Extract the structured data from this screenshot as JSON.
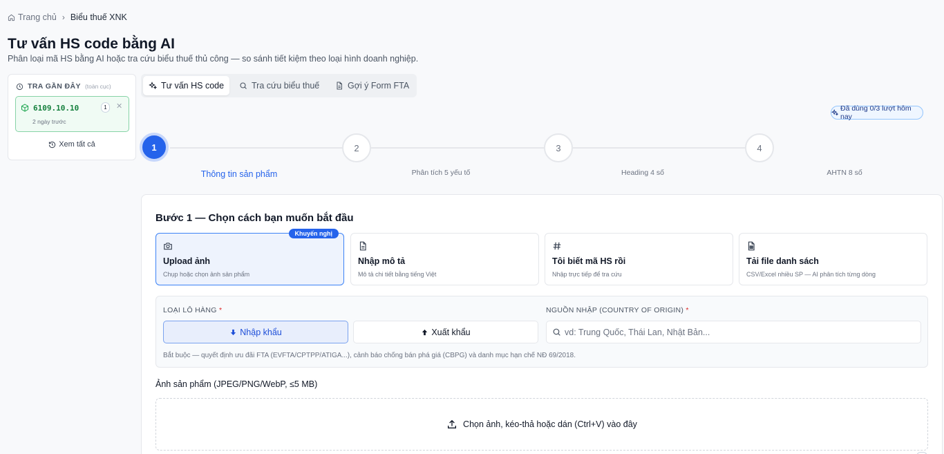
{
  "breadcrumb": {
    "home": "Trang chủ",
    "current": "Biểu thuế XNK"
  },
  "page": {
    "title": "Tư vấn HS code bằng AI",
    "subtitle": "Phân loại mã HS bằng AI hoặc tra cứu biểu thuế thủ công — so sánh tiết kiệm theo loại hình doanh nghiệp."
  },
  "recent": {
    "title": "TRA GẦN ĐÂY",
    "scope": "(toàn cục)",
    "items": [
      {
        "code": "6109.10.10",
        "count": "1",
        "time": "2 ngày trước"
      }
    ],
    "view_all": "Xem tất cả"
  },
  "tabs": [
    {
      "label": "Tư vấn HS code",
      "icon": "sparkles-icon",
      "active": true
    },
    {
      "label": "Tra cứu biểu thuế",
      "icon": "search-icon",
      "active": false
    },
    {
      "label": "Gợi ý Form FTA",
      "icon": "document-icon",
      "active": false
    }
  ],
  "usage": {
    "label": "Đã dùng 0/3 lượt hôm nay"
  },
  "steps": [
    {
      "num": "1",
      "label": "Thông tin sản phẩm",
      "active": true
    },
    {
      "num": "2",
      "label": "Phân tích 5 yếu tố",
      "active": false
    },
    {
      "num": "3",
      "label": "Heading 4 số",
      "active": false
    },
    {
      "num": "4",
      "label": "AHTN 8 số",
      "active": false
    }
  ],
  "step1": {
    "title": "Bước 1 — Chọn cách bạn muốn bắt đầu",
    "options": [
      {
        "name": "Upload ảnh",
        "desc": "Chụp hoặc chọn ảnh sản phẩm",
        "icon": "camera-icon",
        "badge": "Khuyến nghị",
        "active": true
      },
      {
        "name": "Nhập mô tả",
        "desc": "Mô tả chi tiết bằng tiếng Việt",
        "icon": "file-text-icon",
        "active": false
      },
      {
        "name": "Tôi biết mã HS rồi",
        "desc": "Nhập trực tiếp để tra cứu",
        "icon": "hash-icon",
        "active": false
      },
      {
        "name": "Tải file danh sách",
        "desc": "CSV/Excel nhiều SP — AI phân tích từng dòng",
        "icon": "spreadsheet-icon",
        "active": false
      }
    ]
  },
  "shipment": {
    "label": "LOẠI LÔ HÀNG",
    "req": "*",
    "import_label": "Nhập khẩu",
    "export_label": "Xuất khẩu",
    "selected": "import"
  },
  "origin": {
    "label": "NGUỒN NHẬP (COUNTRY OF ORIGIN)",
    "req": "*",
    "placeholder": "vd: Trung Quốc, Thái Lan, Nhật Bản...",
    "value": ""
  },
  "hint": "Bắt buộc — quyết định ưu đãi FTA (EVFTA/CPTPP/ATIGA...), cảnh báo chống bán phá giá (CBPG) và danh mục hạn chế NĐ 69/2018.",
  "image_upload": {
    "label": "Ảnh sản phẩm (JPEG/PNG/WebP, ≤5 MB)",
    "drop_text": "Chọn ảnh, kéo-thả hoặc dán (Ctrl+V) vào đây"
  },
  "colors": {
    "primary": "#2563eb",
    "recent_accent": "#15803d",
    "required": "#dc2626"
  }
}
